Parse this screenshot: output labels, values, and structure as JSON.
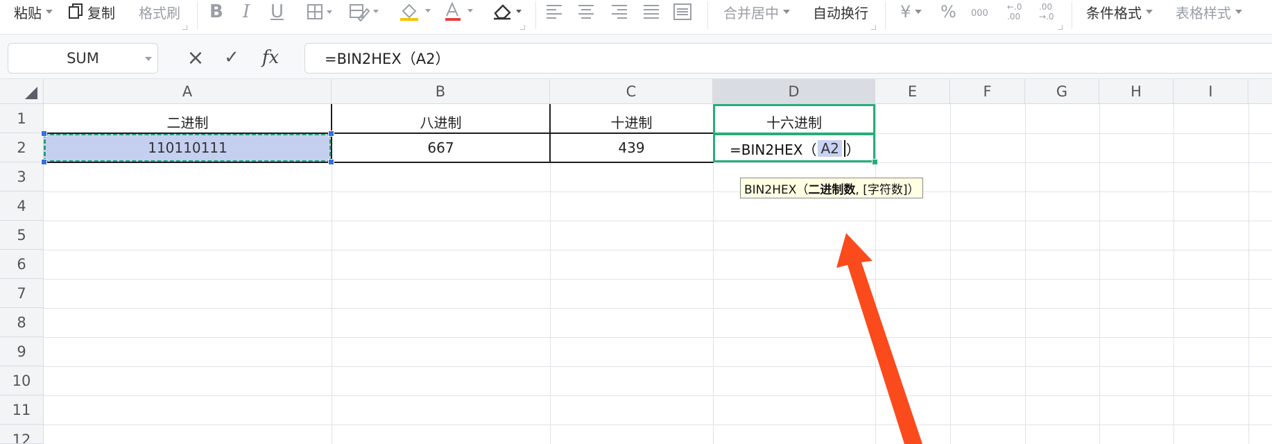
{
  "toolbar": {
    "paste": "粘贴",
    "copy": "复制",
    "format_painter": "格式刷",
    "bold": "B",
    "italic": "I",
    "underline": "U",
    "merge_center": "合并居中",
    "wrap_text": "自动换行",
    "currency": "¥",
    "percent": "%",
    "thousands": "000",
    "decrease_decimal": "←.0 .00",
    "increase_decimal": ".00 →.0",
    "conditional_format": "条件格式",
    "table_style": "表格样式",
    "icons": [
      "copy-icon",
      "borders-icon",
      "fill-color-icon",
      "font-color-icon",
      "clear-format-icon",
      "align-left-icon",
      "align-center-icon",
      "align-right-icon",
      "justify-icon",
      "distributed-icon"
    ]
  },
  "formula_bar": {
    "name_box": "SUM",
    "cancel": "×",
    "confirm": "✓",
    "fx": "fx",
    "formula": "=BIN2HEX（A2）"
  },
  "columns": [
    "A",
    "B",
    "C",
    "D",
    "E",
    "F",
    "G",
    "H",
    "I"
  ],
  "rows": [
    "1",
    "2",
    "3",
    "4",
    "5",
    "6",
    "7",
    "8",
    "9",
    "10",
    "11",
    "12"
  ],
  "cells": {
    "A1": "二进制",
    "B1": "八进制",
    "C1": "十进制",
    "D1": "十六进制",
    "A2": "110110111",
    "B2": "667",
    "C2": "439"
  },
  "editing": {
    "prefix": "=BIN2HEX（",
    "ref": "A2",
    "suffix": "）"
  },
  "tooltip": {
    "func": "BIN2HEX（",
    "arg_bold": "二进制数",
    "rest": ", [字符数]）"
  },
  "colors": {
    "selection_green": "#27ad7a",
    "reference_fill": "#c5d0f0",
    "arrow": "#fb4a1c",
    "tooltip_bg": "#ffffe4"
  }
}
